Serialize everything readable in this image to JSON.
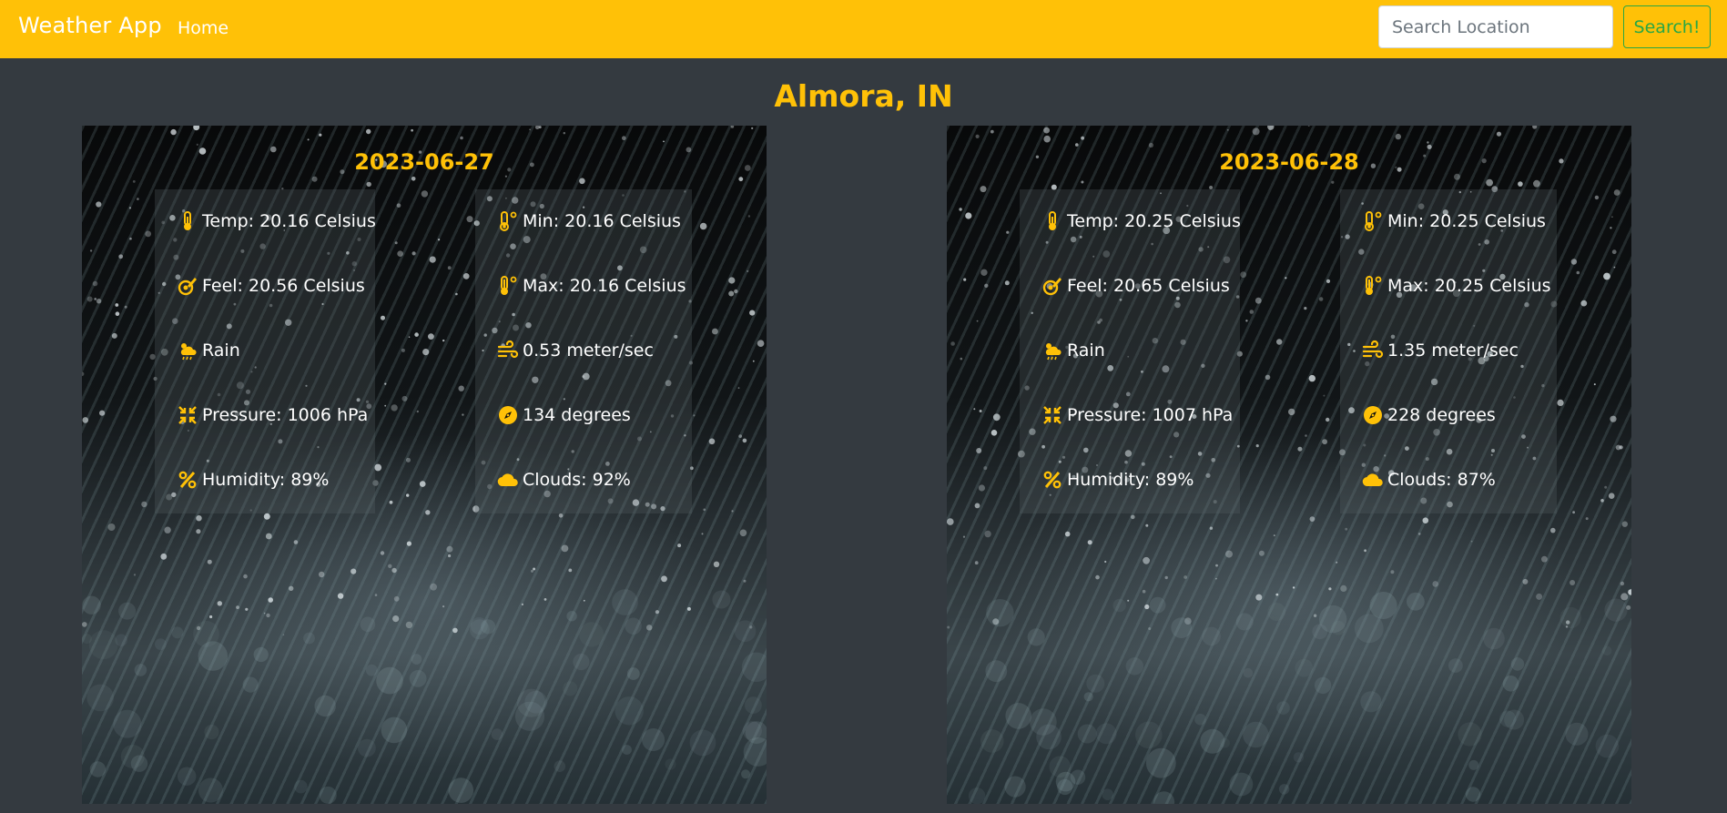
{
  "navbar": {
    "brand": "Weather App",
    "home": "Home",
    "search_placeholder": "Search Location",
    "search_button": "Search!"
  },
  "location": "Almora, IN",
  "colors": {
    "accent": "#ffc107",
    "background": "#343a40",
    "button": "#28a745"
  },
  "forecasts": [
    {
      "date": "2023-06-27",
      "temp": "Temp: 20.16 Celsius",
      "feel": "Feel: 20.56 Celsius",
      "condition": "Rain",
      "pressure": "Pressure: 1006 hPa",
      "humidity": "Humidity: 89%",
      "min": "Min: 20.16 Celsius",
      "max": "Max: 20.16 Celsius",
      "wind_speed": "0.53 meter/sec",
      "wind_deg": "134 degrees",
      "clouds": "Clouds: 92%"
    },
    {
      "date": "2023-06-28",
      "temp": "Temp: 20.25 Celsius",
      "feel": "Feel: 20.65 Celsius",
      "condition": "Rain",
      "pressure": "Pressure: 1007 hPa",
      "humidity": "Humidity: 89%",
      "min": "Min: 20.25 Celsius",
      "max": "Max: 20.25 Celsius",
      "wind_speed": "1.35 meter/sec",
      "wind_deg": "228 degrees",
      "clouds": "Clouds: 87%"
    }
  ],
  "icons": {
    "temp": "thermometer-icon",
    "feel": "feel-gauge-icon",
    "condition": "cloud-sun-rain-icon",
    "pressure": "compress-icon",
    "humidity": "percent-icon",
    "min": "temperature-low-icon",
    "max": "temperature-high-icon",
    "wind_speed": "wind-icon",
    "wind_deg": "compass-icon",
    "clouds": "cloud-icon"
  }
}
